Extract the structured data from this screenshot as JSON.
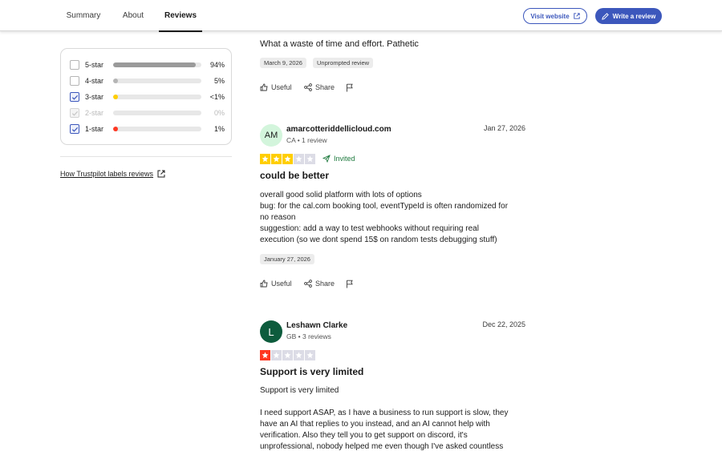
{
  "nav": {
    "tabs": [
      {
        "label": "Summary",
        "active": false
      },
      {
        "label": "About",
        "active": false
      },
      {
        "label": "Reviews",
        "active": true
      }
    ],
    "visit_website_label": "Visit website",
    "write_review_label": "Write a review"
  },
  "filter": {
    "rows": [
      {
        "label": "5-star",
        "percent": "94%",
        "fill": 0.94,
        "color": "#9a9a9a",
        "checked": false,
        "disabled": false
      },
      {
        "label": "4-star",
        "percent": "5%",
        "fill": 0.05,
        "color": "#b5b5b5",
        "checked": false,
        "disabled": false
      },
      {
        "label": "3-star",
        "percent": "<1%",
        "fill": 0.05,
        "color": "#ffce00",
        "checked": true,
        "disabled": false
      },
      {
        "label": "2-star",
        "percent": "0%",
        "fill": 0.0,
        "color": "#e0e0e0",
        "checked": false,
        "disabled": true
      },
      {
        "label": "1-star",
        "percent": "1%",
        "fill": 0.05,
        "color": "#ff3722",
        "checked": true,
        "disabled": false
      }
    ]
  },
  "labels_link": "How Trustpilot labels reviews",
  "review1": {
    "text": "What a waste of time and effort. Pathetic",
    "date_badge": "March 9, 2026",
    "tag": "Unprompted review",
    "useful": "Useful",
    "share": "Share"
  },
  "review2": {
    "initials": "AM",
    "author": "amarcotteriddellicloud.com",
    "meta": "CA • 1 review",
    "date": "Jan 27, 2026",
    "rating": 3,
    "star_color": "#ffce00",
    "invited": "Invited",
    "title": "could be better",
    "lines": [
      "overall good solid platform with lots of options",
      "bug: for the cal.com booking tool, eventTypeId is often randomized for",
      "no reason",
      "suggestion: add a way to test webhooks without requiring real",
      "execution (so we dont spend 15$ on random tests debugging stuff)"
    ],
    "date_badge": "January 27, 2026",
    "useful": "Useful",
    "share": "Share"
  },
  "review3": {
    "initials": "L",
    "author": "Leshawn Clarke",
    "meta": "GB • 3 reviews",
    "date": "Dec 22, 2025",
    "rating": 1,
    "star_color": "#ff3722",
    "title": "Support is very limited",
    "lines": [
      "Support is very limited",
      "",
      "I need support ASAP, as I have a business to run support is slow, they",
      "have an AI that replies to you instead, and an AI cannot help with",
      "verification. Also they tell you to get support on discord, it's",
      "unprofessional, nobody helped me even though I've asked countless"
    ]
  }
}
